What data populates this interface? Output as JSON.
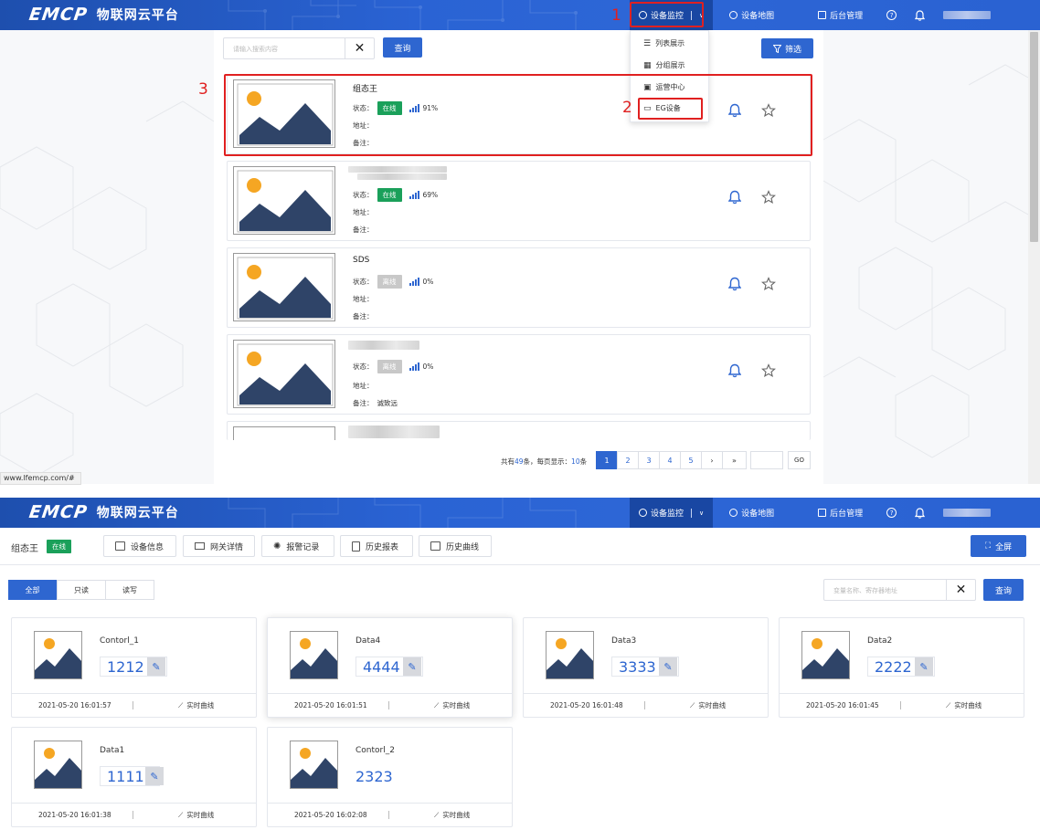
{
  "header": {
    "brand": "EMCP",
    "subtitle": "物联网云平台",
    "nav": [
      {
        "label": "设备监控",
        "icon": "monitor-icon",
        "active": true
      },
      {
        "label": "设备地图",
        "icon": "user-icon"
      },
      {
        "label": "后台管理",
        "icon": "admin-icon"
      }
    ]
  },
  "annotations": {
    "n1": "1",
    "n2": "2",
    "n3": "3"
  },
  "search": {
    "placeholder": "请输入搜索内容",
    "button": "查询",
    "filter": "筛选"
  },
  "dropdown": [
    {
      "label": "列表展示",
      "icon": "list-icon"
    },
    {
      "label": "分组展示",
      "icon": "group-icon"
    },
    {
      "label": "运营中心",
      "icon": "operation-icon"
    },
    {
      "label": "EG设备",
      "icon": "eg-device-icon"
    }
  ],
  "device_labels": {
    "status": "状态：",
    "address": "地址：",
    "remark": "备注："
  },
  "devices": [
    {
      "name": "组态王",
      "status": "在线",
      "online": true,
      "signal": "91%",
      "address": "",
      "remark": ""
    },
    {
      "name": "",
      "status": "在线",
      "online": true,
      "signal": "69%",
      "address": "",
      "remark": ""
    },
    {
      "name": "SDS",
      "status": "离线",
      "online": false,
      "signal": "0%",
      "address": "",
      "remark": ""
    },
    {
      "name": "",
      "status": "离线",
      "online": false,
      "signal": "0%",
      "address": "",
      "remark": "诚致远"
    }
  ],
  "pagination": {
    "summary_pre": "共有",
    "total": "49",
    "summary_mid": "条，每页显示：",
    "per_page": "10",
    "summary_post": "条",
    "pages": [
      "1",
      "2",
      "3",
      "4",
      "5",
      "›",
      "»"
    ],
    "go": "GO"
  },
  "status_url": "www.lfemcp.com/#",
  "detail": {
    "device_name": "组态王",
    "status": "在线",
    "tabs": [
      {
        "label": "设备信息",
        "icon": "device-info-icon"
      },
      {
        "label": "网关详情",
        "icon": "gateway-icon"
      },
      {
        "label": "报警记录",
        "icon": "alarm-icon"
      },
      {
        "label": "历史报表",
        "icon": "report-icon"
      },
      {
        "label": "历史曲线",
        "icon": "history-curve-icon"
      }
    ],
    "fullscreen": "全屏",
    "filters": [
      "全部",
      "只读",
      "读写"
    ],
    "search_placeholder": "变量名称、寄存器地址",
    "search_button": "查询",
    "realtime_label": "实时曲线",
    "variables": [
      {
        "name": "Contorl_1",
        "value": "1212",
        "time": "2021-05-20 16:01:57",
        "editable": true
      },
      {
        "name": "Data4",
        "value": "4444",
        "time": "2021-05-20 16:01:51",
        "editable": true
      },
      {
        "name": "Data3",
        "value": "3333",
        "time": "2021-05-20 16:01:48",
        "editable": true
      },
      {
        "name": "Data2",
        "value": "2222",
        "time": "2021-05-20 16:01:45",
        "editable": true
      },
      {
        "name": "Data1",
        "value": "1111",
        "time": "2021-05-20 16:01:38",
        "editable": true
      },
      {
        "name": "Contorl_2",
        "value": "2323",
        "time": "2021-05-20 16:02:08",
        "editable": false
      }
    ]
  },
  "colors": {
    "primary": "#2e66d0",
    "online": "#1aa05a",
    "offline": "#c8c8c8",
    "highlight": "#e02020",
    "sun": "#f5a623",
    "mountain": "#2f4468"
  }
}
